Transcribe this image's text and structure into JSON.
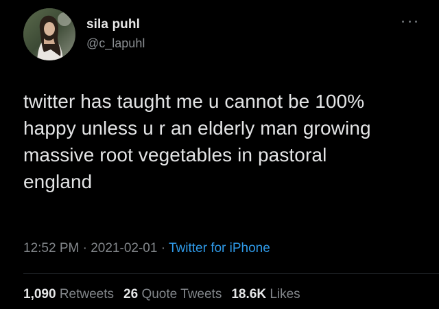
{
  "user": {
    "display_name": "sila puhl",
    "handle": "@c_lapuhl",
    "avatar": "profile-photo"
  },
  "menu_icon": "more-horizontal-icon",
  "tweet": {
    "text": "twitter has taught me u cannot be 100%\nhappy unless u r an elderly man growing\nmassive root vegetables in pastoral\nengland"
  },
  "meta": {
    "time": "12:52 PM",
    "separator": " · ",
    "date": "2021-02-01",
    "source": "Twitter for iPhone"
  },
  "stats": {
    "retweets_count": "1,090",
    "retweets_label": "Retweets",
    "quotes_count": "26",
    "quotes_label": "Quote Tweets",
    "likes_count": "18.6K",
    "likes_label": "Likes"
  },
  "colors": {
    "background": "#000000",
    "text": "#e3e4e5",
    "muted": "#83878b",
    "link": "#2f9ae8"
  }
}
